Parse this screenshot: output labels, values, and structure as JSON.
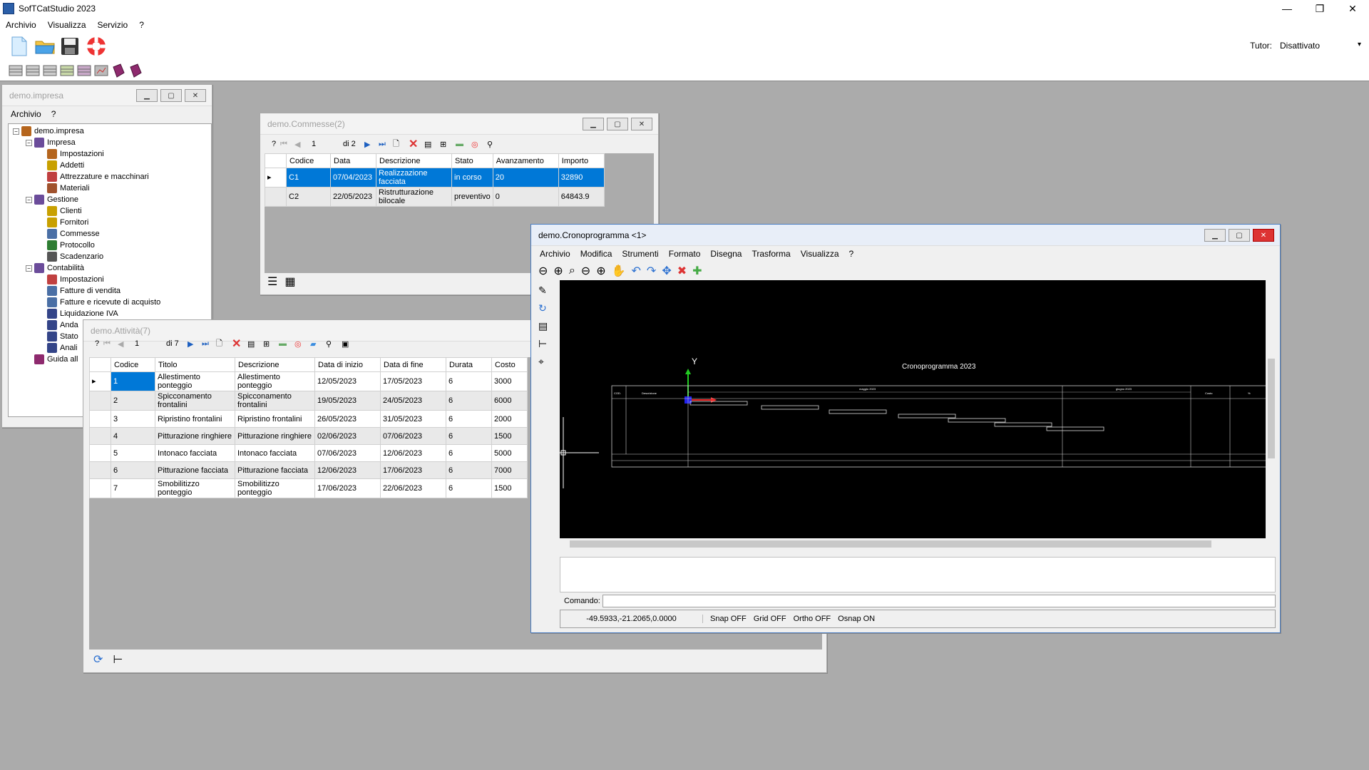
{
  "app": {
    "title": "SofTCatStudio 2023"
  },
  "menubar": [
    "Archivio",
    "Visualizza",
    "Servizio",
    "?"
  ],
  "tutor": {
    "label": "Tutor:",
    "value": "Disattivato"
  },
  "impresa_window": {
    "title": "demo.impresa",
    "menu": [
      "Archivio",
      "?"
    ],
    "tree": [
      {
        "label": "demo.impresa",
        "level": 0,
        "expander": "−",
        "icon": "house-icon",
        "color": "#b5651d"
      },
      {
        "label": "Impresa",
        "level": 1,
        "expander": "−",
        "icon": "org-icon",
        "color": "#6b4c9a"
      },
      {
        "label": "Impostazioni",
        "level": 2,
        "icon": "house-icon",
        "color": "#b5651d"
      },
      {
        "label": "Addetti",
        "level": 2,
        "icon": "worker-icon",
        "color": "#c8a000"
      },
      {
        "label": "Attrezzature e macchinari",
        "level": 2,
        "icon": "tools-icon",
        "color": "#c04040"
      },
      {
        "label": "Materiali",
        "level": 2,
        "icon": "bricks-icon",
        "color": "#a0522d"
      },
      {
        "label": "Gestione",
        "level": 1,
        "expander": "−",
        "icon": "org-icon",
        "color": "#6b4c9a"
      },
      {
        "label": "Clienti",
        "level": 2,
        "icon": "worker-icon",
        "color": "#c8a000"
      },
      {
        "label": "Fornitori",
        "level": 2,
        "icon": "worker-icon",
        "color": "#c8a000"
      },
      {
        "label": "Commesse",
        "level": 2,
        "icon": "table-icon",
        "color": "#4a6fa5"
      },
      {
        "label": "Protocollo",
        "level": 2,
        "icon": "globe-icon",
        "color": "#2e7d32"
      },
      {
        "label": "Scadenzario",
        "level": 2,
        "icon": "calendar-icon",
        "color": "#555555"
      },
      {
        "label": "Contabilità",
        "level": 1,
        "expander": "−",
        "icon": "org-icon",
        "color": "#6b4c9a"
      },
      {
        "label": "Impostazioni",
        "level": 2,
        "icon": "settings-icon",
        "color": "#c04040"
      },
      {
        "label": "Fatture di vendita",
        "level": 2,
        "icon": "table-icon",
        "color": "#4a6fa5"
      },
      {
        "label": "Fatture e ricevute di acquisto",
        "level": 2,
        "icon": "table-icon",
        "color": "#4a6fa5"
      },
      {
        "label": "Liquidazione IVA",
        "level": 2,
        "icon": "report-icon",
        "color": "#334488"
      },
      {
        "label": "Anda",
        "level": 2,
        "icon": "report-icon",
        "color": "#334488"
      },
      {
        "label": "Stato",
        "level": 2,
        "icon": "report-icon",
        "color": "#334488"
      },
      {
        "label": "Anali",
        "level": 2,
        "icon": "report-icon",
        "color": "#334488"
      },
      {
        "label": "Guida all",
        "level": 1,
        "icon": "book-icon",
        "color": "#8e2a6e"
      }
    ]
  },
  "commesse_window": {
    "title": "demo.Commesse(2)",
    "nav": {
      "help": "?",
      "position": "1",
      "of": "di 2"
    },
    "columns": [
      "Codice",
      "Data",
      "Descrizione",
      "Stato",
      "Avanzamento",
      "Importo"
    ],
    "rows": [
      [
        "C1",
        "07/04/2023",
        "Realizzazione facciata",
        "in corso",
        "20",
        "32890"
      ],
      [
        "C2",
        "22/05/2023",
        "Ristrutturazione bilocale",
        "preventivo",
        "0",
        "64843.9"
      ]
    ]
  },
  "attivita_window": {
    "title": "demo.Attività(7)",
    "nav": {
      "help": "?",
      "position": "1",
      "of": "di 7"
    },
    "columns": [
      "Codice",
      "Titolo",
      "Descrizione",
      "Data di inizio",
      "Data di fine",
      "Durata",
      "Costo"
    ],
    "rows": [
      [
        "1",
        "Allestimento ponteggio",
        "Allestimento ponteggio",
        "12/05/2023",
        "17/05/2023",
        "6",
        "3000"
      ],
      [
        "2",
        "Spicconamento frontalini",
        "Spicconamento frontalini",
        "19/05/2023",
        "24/05/2023",
        "6",
        "6000"
      ],
      [
        "3",
        "Ripristino frontalini",
        "Ripristino frontalini",
        "26/05/2023",
        "31/05/2023",
        "6",
        "2000"
      ],
      [
        "4",
        "Pitturazione ringhiere",
        "Pitturazione ringhiere",
        "02/06/2023",
        "07/06/2023",
        "6",
        "1500"
      ],
      [
        "5",
        "Intonaco facciata",
        "Intonaco facciata",
        "07/06/2023",
        "12/06/2023",
        "6",
        "5000"
      ],
      [
        "6",
        "Pitturazione facciata",
        "Pitturazione facciata",
        "12/06/2023",
        "17/06/2023",
        "6",
        "7000"
      ],
      [
        "7",
        "Smobilitizzo ponteggio",
        "Smobilitizzo ponteggio",
        "17/06/2023",
        "22/06/2023",
        "6",
        "1500"
      ]
    ]
  },
  "crono_window": {
    "title": "demo.Cronoprogramma <1>",
    "menu": [
      "Archivio",
      "Modifica",
      "Strumenti",
      "Formato",
      "Disegna",
      "Trasforma",
      "Visualizza",
      "?"
    ],
    "drawing": {
      "title": "Cronoprogramma 2023",
      "axis_y": "Y",
      "col_cod": "COD.",
      "col_desc": "Descrizione",
      "col_costo": "Costo",
      "col_pct": "%",
      "month1": "maggio 2023",
      "month2": "giugno 2023"
    },
    "command_label": "Comando:",
    "status": {
      "coords": "-49.5933,-21.2065,0.0000",
      "snap": "Snap OFF",
      "grid": "Grid OFF",
      "ortho": "Ortho OFF",
      "osnap": "Osnap ON"
    }
  },
  "colors": {
    "selection": "#0078d7",
    "accent_red": "#d33333",
    "cad_bg": "#000000"
  }
}
